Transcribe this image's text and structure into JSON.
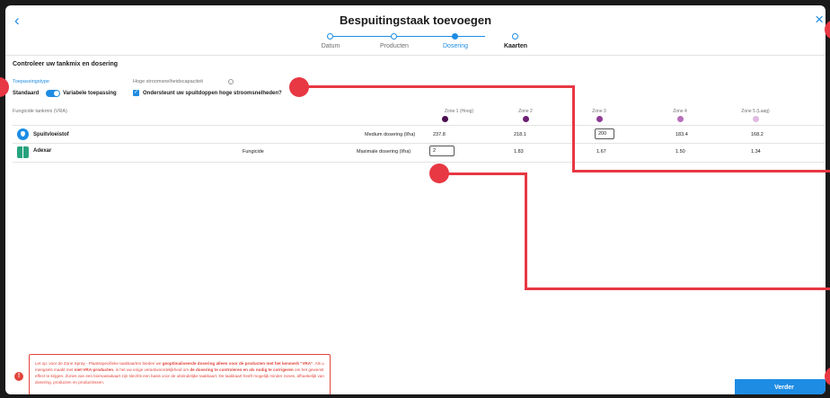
{
  "header": {
    "title": "Bespuitingstaak toevoegen",
    "back_icon": "‹",
    "close_icon": "×",
    "steps": [
      {
        "label": "Datum",
        "state": "done"
      },
      {
        "label": "Producten",
        "state": "done"
      },
      {
        "label": "Dosering",
        "state": "active"
      },
      {
        "label": "Kaarten",
        "state": "next"
      }
    ]
  },
  "main": {
    "section_title": "Controleer uw tankmix en dosering",
    "application_type": {
      "label": "Toepassingstype",
      "option_left": "Standaard",
      "option_right": "Variabele toepassing",
      "selected": "Variabele toepassing"
    },
    "high_flow": {
      "label": "Hoge stroomsnelheidscapaciteit",
      "info_icon": "i",
      "checkbox_label": "Ondersteunt uw spuitdoppen hoge stroomsnelheden?",
      "checked": true
    },
    "tank_mix_label": "Fungicide tankmix (VRA)",
    "zones": [
      {
        "label": "Zone 1 (Hoog)",
        "color": "#4b0e4f"
      },
      {
        "label": "Zone 2",
        "color": "#6b1f72"
      },
      {
        "label": "Zone 3",
        "color": "#8e3b95"
      },
      {
        "label": "Zone 4",
        "color": "#b76fbd"
      },
      {
        "label": "Zone 5 (Laag)",
        "color": "#e0b9e3"
      }
    ],
    "rows": [
      {
        "name": "Spuitvloeistof",
        "category": "",
        "dose_label": "Medium dosering (l/ha)",
        "values": [
          "237.8",
          "218.1",
          "200",
          "183.4",
          "168.2"
        ]
      },
      {
        "name": "Adexar",
        "category": "Fungicide",
        "dose_label": "Maximale dosering (l/ha)",
        "values": [
          "2",
          "1.83",
          "1.67",
          "1.50",
          "1.34"
        ]
      }
    ]
  },
  "warning": {
    "icon": "!",
    "part1": "Let op: voor de Zone Spray - Plaatsspecifieke taakkaarten bieden we ",
    "part1_bold": "geoptimaliseerde dosering alleen voor de producten met het kenmerk \"VRA\"",
    "part2": ". Als u mengsels maakt met ",
    "part2_bold": "niet-VRA-producten",
    "part3": ", is het uw enige verantwoordelijkheid om ",
    "part3_bold": "de dosering te controleren en als nodig te corrigeren",
    "part4": " om het gewenst effect te krijgen. Zones van een biomassakaart zijn slechts een basis voor de uiteindelijke taakkaart. De taakkaart heeft mogelijk minder zones, afhankelijk van dosering, producten en productmixen."
  },
  "footer": {
    "next_label": "Verder"
  },
  "colors": {
    "accent": "#1e8ce3",
    "annotation": "#e73843",
    "warning": "#e2453c"
  }
}
